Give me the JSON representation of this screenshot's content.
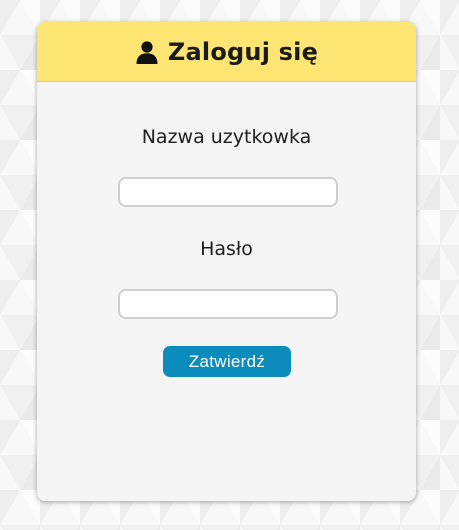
{
  "login": {
    "header": {
      "icon": "user-icon",
      "title": "Zaloguj się",
      "background": "#fde574"
    },
    "username": {
      "label": "Nazwa uzytkowka",
      "value": "",
      "placeholder": ""
    },
    "password": {
      "label": "Hasło",
      "value": "",
      "placeholder": ""
    },
    "submit": {
      "label": "Zatwierdź",
      "color": "#0b8cbc"
    }
  }
}
